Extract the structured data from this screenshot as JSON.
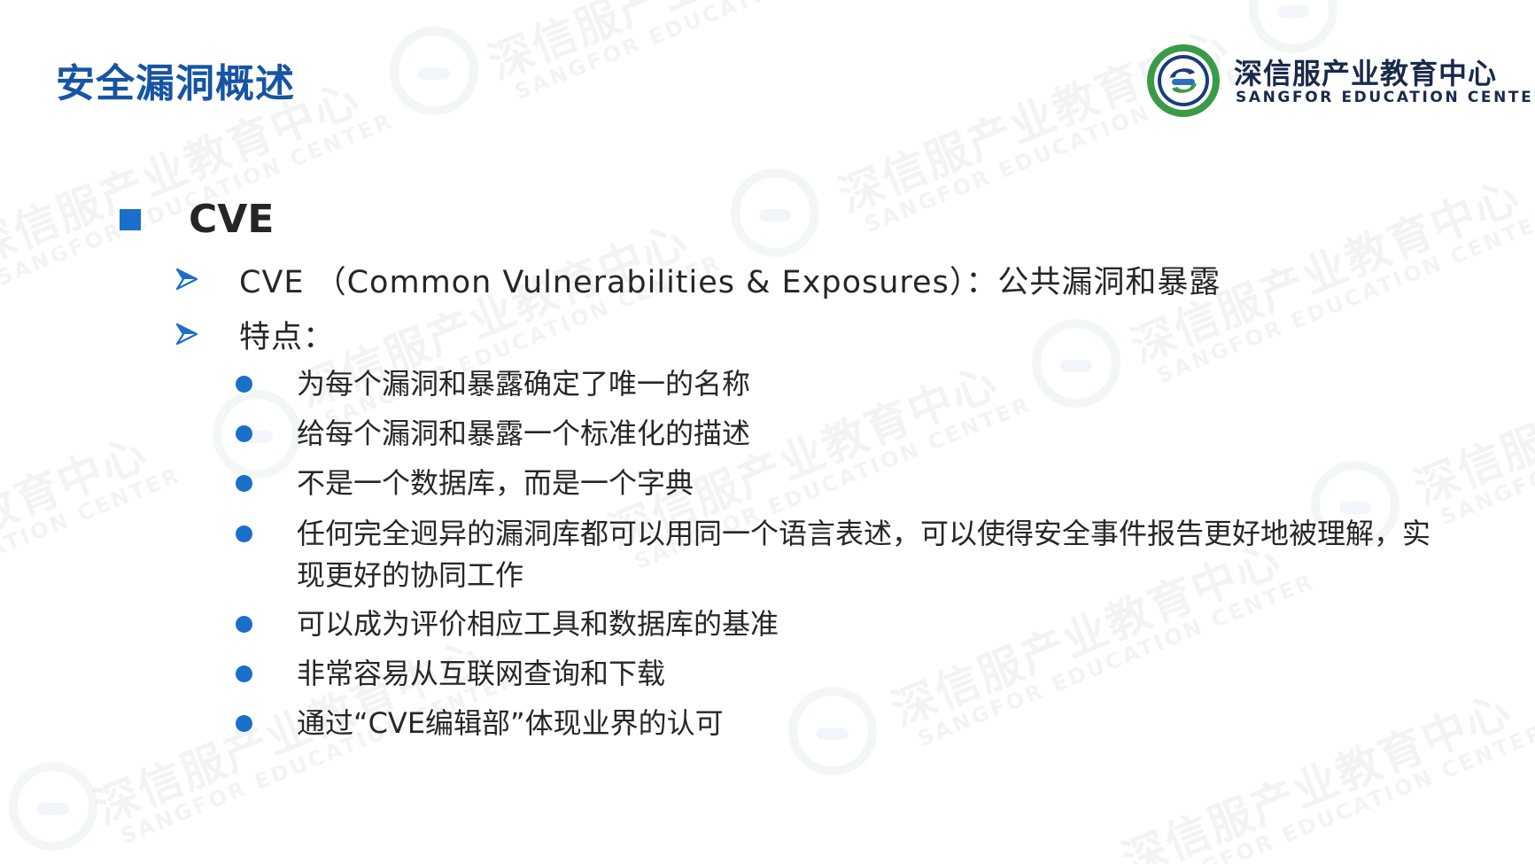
{
  "header": {
    "title": "安全漏洞概述",
    "logo": {
      "name_cn": "深信服产业教育中心",
      "name_en": "SANGFOR EDUCATION CENTER",
      "emblem_icon": "sangfor-education-emblem-icon"
    }
  },
  "watermark": {
    "text_cn": "深信服产业教育中心",
    "text_en": "SANGFOR EDUCATION CENTER"
  },
  "section": {
    "title": "CVE",
    "sub_items": [
      {
        "text": "CVE （Common Vulnerabilities & Exposures）：公共漏洞和暴露"
      },
      {
        "text": "特点："
      }
    ],
    "bullets": [
      {
        "text": "为每个漏洞和暴露确定了唯一的名称"
      },
      {
        "text": "给每个漏洞和暴露一个标准化的描述"
      },
      {
        "text": "不是一个数据库，而是一个字典"
      },
      {
        "text": "任何完全迥异的漏洞库都可以用同一个语言表述，可以使得安全事件报告更好地被理解，实现更好的协同工作"
      },
      {
        "text": "可以成为评价相应工具和数据库的基准"
      },
      {
        "text": "非常容易从互联网查询和下载"
      },
      {
        "text": "通过“CVE编辑部”体现业界的认可"
      }
    ]
  },
  "colors": {
    "title_blue": "#1655a3",
    "bullet_blue": "#1a6fc9",
    "text_dark": "#262626",
    "logo_green": "#3a9a48"
  }
}
